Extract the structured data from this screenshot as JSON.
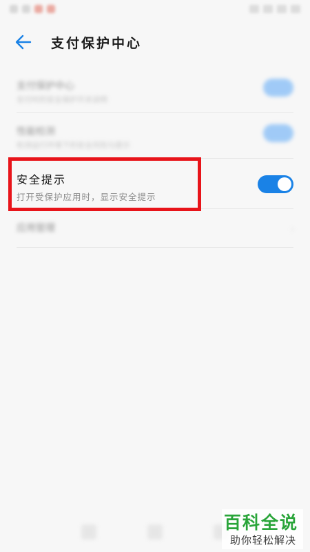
{
  "header": {
    "title": "支付保护中心"
  },
  "rows": {
    "row1": {
      "title": "支付保护中心",
      "desc": "支付时的安全保护开关说明"
    },
    "row2": {
      "title": "性能检测",
      "desc": "检测运行环境下的安全风险与提示"
    },
    "row4": {
      "title": "应用管理"
    }
  },
  "safety_tip": {
    "title": "安全提示",
    "desc": "打开受保护应用时，显示安全提示",
    "toggle_on": true
  },
  "watermark": {
    "main": "百科全说",
    "sub": "助你轻松解决"
  },
  "colors": {
    "toggle_on": "#1a82e6",
    "highlight": "#e8141a",
    "watermark_green": "#2aa53a"
  },
  "icons": {
    "back": "arrow-left-icon",
    "toggle": "switch-icon"
  }
}
